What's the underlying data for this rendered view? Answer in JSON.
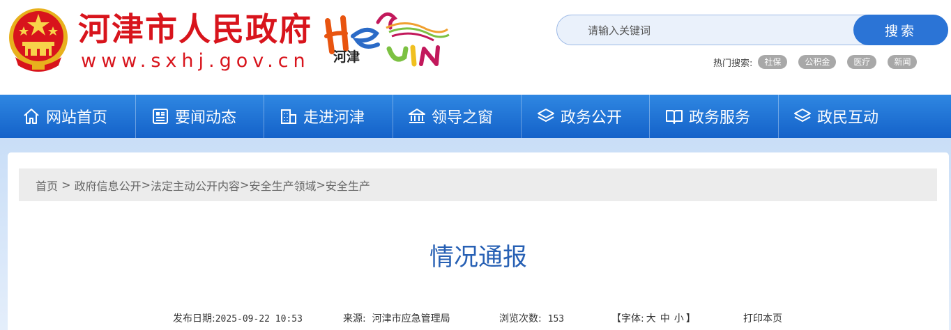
{
  "header": {
    "site_title": "河津市人民政府",
    "site_url": "www.sxhj.gov.cn",
    "brand_logo_text": "河津"
  },
  "search": {
    "placeholder": "请输入关键词",
    "button_label": "搜索",
    "hot_label": "热门搜索:",
    "hot_tags": [
      "社保",
      "公积金",
      "医疗",
      "新闻"
    ]
  },
  "nav": {
    "items": [
      {
        "label": "网站首页",
        "icon": "home-icon"
      },
      {
        "label": "要闻动态",
        "icon": "news-icon"
      },
      {
        "label": "走进河津",
        "icon": "building-icon"
      },
      {
        "label": "领导之窗",
        "icon": "bank-icon"
      },
      {
        "label": "政务公开",
        "icon": "layers-icon"
      },
      {
        "label": "政务服务",
        "icon": "book-icon"
      },
      {
        "label": "政民互动",
        "icon": "layers-icon"
      }
    ]
  },
  "breadcrumb": {
    "items": [
      "首页",
      " > ",
      "政府信息公开",
      ">",
      "法定主动公开内容",
      ">",
      "安全生产领域",
      ">",
      "安全生产"
    ]
  },
  "article": {
    "title": "情况通报",
    "publish_label": "发布日期:",
    "publish_date": "2025-09-22 10:53",
    "source_label": "来源:",
    "source_value": "河津市应急管理局",
    "views_label": "浏览次数:",
    "views_value": "153",
    "font_label_open": "【字体:",
    "font_large": "大",
    "font_medium": "中",
    "font_small": "小",
    "font_label_close": "】",
    "print_label": "打印本页"
  },
  "colors": {
    "brand_red": "#d8141c",
    "nav_blue": "#1e6fd6",
    "title_blue": "#2760b4"
  }
}
